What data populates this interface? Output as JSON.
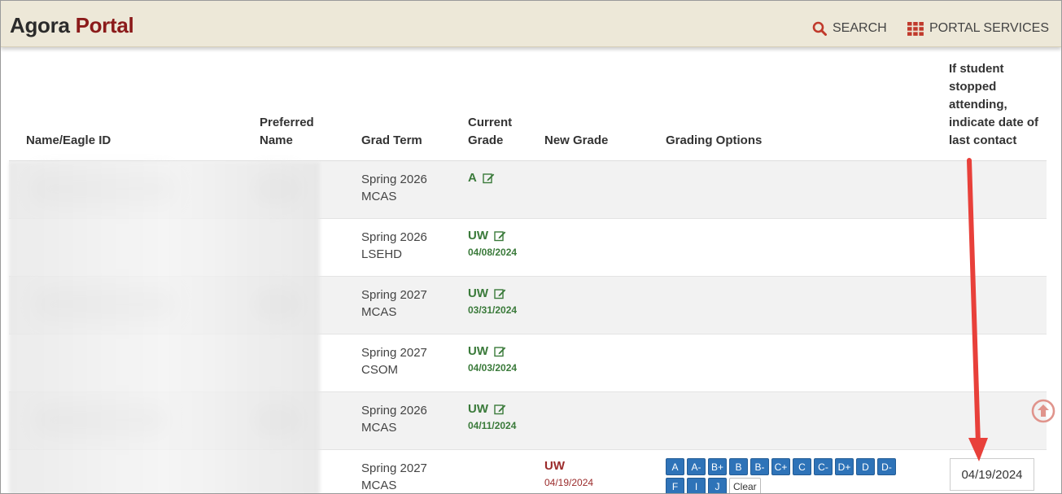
{
  "header": {
    "logo_part1": "Agora",
    "logo_part2": "Portal",
    "search_label": "SEARCH",
    "services_label": "PORTAL SERVICES"
  },
  "columns": {
    "name": "Name/Eagle ID",
    "preferred_line1": "Preferred",
    "preferred_line2": "Name",
    "grad_term": "Grad Term",
    "current_line1": "Current",
    "current_line2": "Grade",
    "new_grade": "New Grade",
    "grading_options": "Grading Options",
    "stopped_line1": "If student",
    "stopped_line2": "stopped",
    "stopped_line3": "attending,",
    "stopped_line4": "indicate date of",
    "stopped_line5": "last contact"
  },
  "rows": [
    {
      "term_line1": "Spring 2026",
      "term_line2": "MCAS",
      "current_grade": "A",
      "current_date": ""
    },
    {
      "term_line1": "Spring 2026",
      "term_line2": "LSEHD",
      "current_grade": "UW",
      "current_date": "04/08/2024"
    },
    {
      "term_line1": "Spring 2027",
      "term_line2": "MCAS",
      "current_grade": "UW",
      "current_date": "03/31/2024"
    },
    {
      "term_line1": "Spring 2027",
      "term_line2": "CSOM",
      "current_grade": "UW",
      "current_date": "04/03/2024"
    },
    {
      "term_line1": "Spring 2026",
      "term_line2": "MCAS",
      "current_grade": "UW",
      "current_date": "04/11/2024"
    },
    {
      "term_line1": "Spring 2027",
      "term_line2": "MCAS",
      "new_grade": "UW",
      "new_date": "04/19/2024",
      "last_contact": "04/19/2024"
    }
  ],
  "grade_buttons_row1": [
    "A",
    "A-",
    "B+",
    "B",
    "B-",
    "C+",
    "C",
    "C-",
    "D+",
    "D",
    "D-"
  ],
  "grade_buttons_row2": [
    "F",
    "I",
    "J"
  ],
  "clear_label": "Clear",
  "colors": {
    "header_bg": "#ede8d8",
    "logo_accent": "#8b1a1a",
    "grade_green": "#3a7a3a",
    "new_grade_red": "#9b2b2b",
    "button_blue": "#2e73b8",
    "annotation_arrow": "#e8403a"
  }
}
